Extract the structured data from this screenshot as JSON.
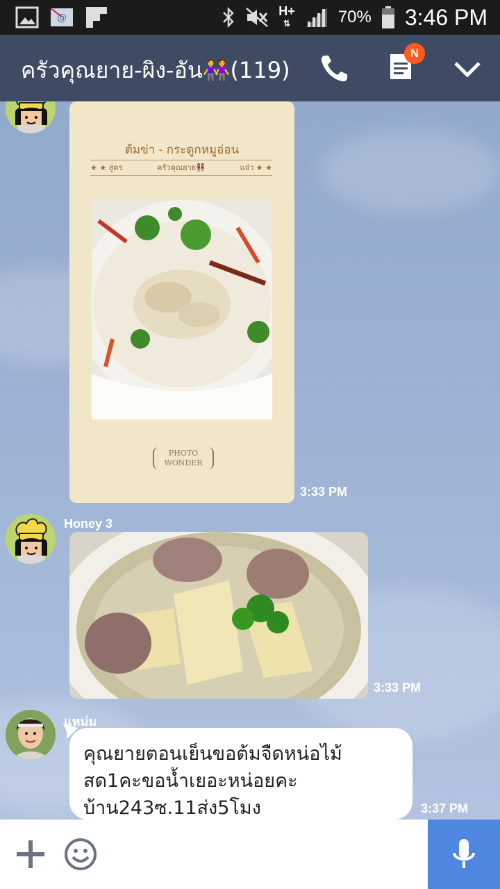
{
  "status_bar": {
    "battery_percent": "70%",
    "time": "3:46 PM",
    "network": "H+",
    "icons": [
      "gallery-icon",
      "email-icon",
      "flipboard-icon",
      "bluetooth-icon",
      "mute-icon",
      "signal-icon",
      "battery-icon"
    ]
  },
  "header": {
    "title": "ครัวคุณยาย-ผิง-อัน👭(119)",
    "notes_badge": "N",
    "icons": [
      "call-icon",
      "notes-icon",
      "chevron-down-icon"
    ]
  },
  "messages": [
    {
      "type": "image",
      "sender": "",
      "time": "3:33 PM",
      "card": {
        "title": "ต้มข่า - กระดูกหมูอ่อน",
        "subtitle_left": "★ ★  สูตร",
        "subtitle_center": "ครัวคุณยาย👭",
        "subtitle_right": "แจ๋ว ★ ★",
        "logo_line1": "PHOTO",
        "logo_line2": "WONDER"
      }
    },
    {
      "type": "image",
      "sender": "Honey 3",
      "time": "3:33 PM"
    },
    {
      "type": "text",
      "sender": "แหม่ม",
      "time": "3:37 PM",
      "text": "คุณยายตอนเย็นขอต้มจืดหน่อไม้สด1คะขอน้ำเยอะหน่อยคะบ้าน243ซ.11ส่ง5โมง"
    }
  ],
  "input_bar": {
    "icons": [
      "plus-icon",
      "emoji-icon",
      "microphone-icon"
    ],
    "accent_color": "#4f86e0"
  },
  "colors": {
    "header_bg": "#3f4a63",
    "status_bg": "#1b1b1b",
    "chat_bg": "#9cb1d3",
    "badge": "#ff5a1f"
  }
}
